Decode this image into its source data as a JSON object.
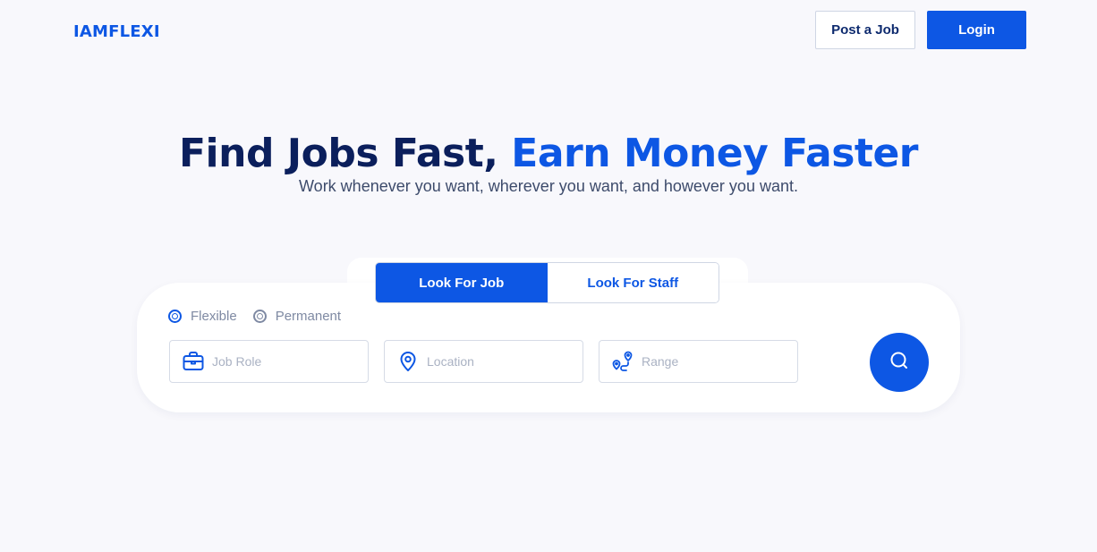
{
  "header": {
    "logo": "IAMFLEXI",
    "post_job_label": "Post a Job",
    "login_label": "Login"
  },
  "hero": {
    "title_part1": "Find Jobs Fast, ",
    "title_part2": "Earn Money Faster",
    "subtitle": "Work whenever you want, wherever you want, and however you want."
  },
  "search": {
    "tabs": [
      {
        "label": "Look For Job",
        "active": true
      },
      {
        "label": "Look For Staff",
        "active": false
      }
    ],
    "job_types": [
      {
        "label": "Flexible"
      },
      {
        "label": "Permanent"
      }
    ],
    "fields": {
      "job_role_placeholder": "Job Role",
      "location_placeholder": "Location",
      "range_placeholder": "Range"
    },
    "icons": {
      "job_role": "briefcase-icon",
      "location": "map-pin-icon",
      "range": "route-icon",
      "submit": "search-icon"
    }
  },
  "colors": {
    "brand": "#0d57e4",
    "heading": "#0b1f5c",
    "background": "#f8f8fc"
  }
}
